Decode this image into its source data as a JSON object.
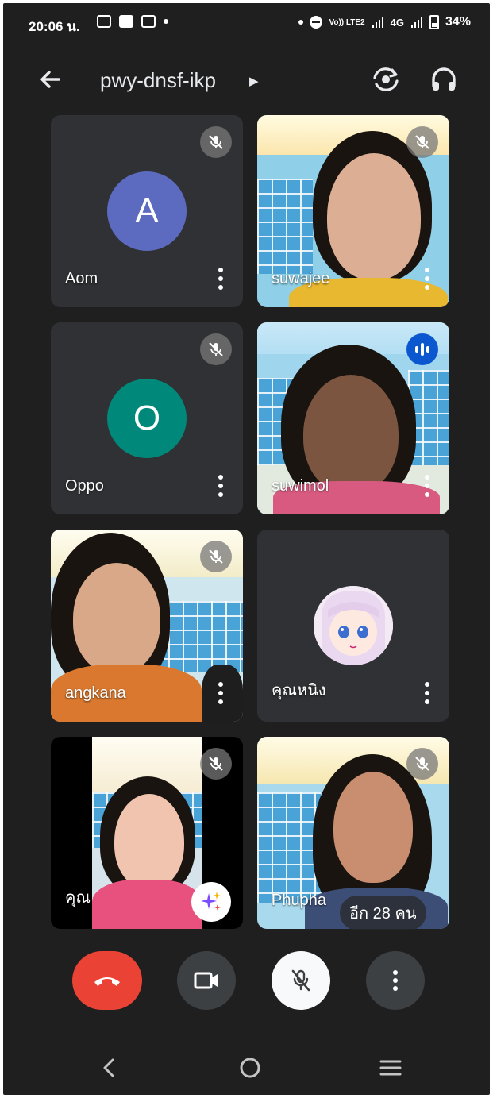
{
  "status_bar": {
    "time": "20:06 น.",
    "volte": "Vo)) LTE2",
    "network": "4G",
    "battery": "34%"
  },
  "header": {
    "meeting_code": "pwy-dnsf-ikp",
    "back_icon": "arrow-left-icon",
    "flip_camera_icon": "camera-flip-icon",
    "audio_icon": "headphones-icon"
  },
  "tiles": [
    {
      "name": "Aom",
      "type": "avatar-letter",
      "letter": "A",
      "color": "#5c6bc0",
      "muted": true
    },
    {
      "name": "suwajee",
      "type": "video",
      "muted": true
    },
    {
      "name": "Oppo",
      "type": "avatar-letter",
      "letter": "O",
      "color": "#00897b",
      "muted": true
    },
    {
      "name": "suwimol",
      "type": "video",
      "speaking": true
    },
    {
      "name": "angkana",
      "type": "video",
      "muted": true
    },
    {
      "name": "คุณหนิง",
      "type": "avatar-image",
      "muted": false
    },
    {
      "name": "คุณ",
      "type": "video",
      "muted": true,
      "self": true
    },
    {
      "name": "Phupha",
      "type": "video",
      "muted": true
    }
  ],
  "more_participants": "อีก 28 คน",
  "controls": {
    "end_call_icon": "phone-hangup-icon",
    "camera_icon": "video-camera-icon",
    "mic_icon": "mic-off-icon",
    "more_icon": "more-vertical-icon",
    "colors": {
      "end": "#ea4335",
      "dark": "#3c4043",
      "mic": "#f8f9fa"
    }
  },
  "nav": {
    "back_icon": "nav-back-icon",
    "home_icon": "nav-home-icon",
    "recents_icon": "nav-recents-icon"
  }
}
